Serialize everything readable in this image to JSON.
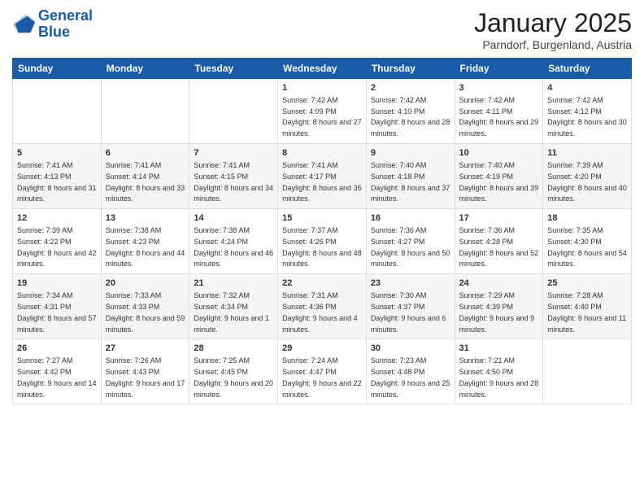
{
  "logo": {
    "line1": "General",
    "line2": "Blue"
  },
  "title": "January 2025",
  "location": "Parndorf, Burgenland, Austria",
  "weekdays": [
    "Sunday",
    "Monday",
    "Tuesday",
    "Wednesday",
    "Thursday",
    "Friday",
    "Saturday"
  ],
  "weeks": [
    [
      {
        "day": "",
        "info": ""
      },
      {
        "day": "",
        "info": ""
      },
      {
        "day": "",
        "info": ""
      },
      {
        "day": "1",
        "info": "Sunrise: 7:42 AM\nSunset: 4:09 PM\nDaylight: 8 hours and 27 minutes."
      },
      {
        "day": "2",
        "info": "Sunrise: 7:42 AM\nSunset: 4:10 PM\nDaylight: 8 hours and 28 minutes."
      },
      {
        "day": "3",
        "info": "Sunrise: 7:42 AM\nSunset: 4:11 PM\nDaylight: 8 hours and 29 minutes."
      },
      {
        "day": "4",
        "info": "Sunrise: 7:42 AM\nSunset: 4:12 PM\nDaylight: 8 hours and 30 minutes."
      }
    ],
    [
      {
        "day": "5",
        "info": "Sunrise: 7:41 AM\nSunset: 4:13 PM\nDaylight: 8 hours and 31 minutes."
      },
      {
        "day": "6",
        "info": "Sunrise: 7:41 AM\nSunset: 4:14 PM\nDaylight: 8 hours and 33 minutes."
      },
      {
        "day": "7",
        "info": "Sunrise: 7:41 AM\nSunset: 4:15 PM\nDaylight: 8 hours and 34 minutes."
      },
      {
        "day": "8",
        "info": "Sunrise: 7:41 AM\nSunset: 4:17 PM\nDaylight: 8 hours and 35 minutes."
      },
      {
        "day": "9",
        "info": "Sunrise: 7:40 AM\nSunset: 4:18 PM\nDaylight: 8 hours and 37 minutes."
      },
      {
        "day": "10",
        "info": "Sunrise: 7:40 AM\nSunset: 4:19 PM\nDaylight: 8 hours and 39 minutes."
      },
      {
        "day": "11",
        "info": "Sunrise: 7:39 AM\nSunset: 4:20 PM\nDaylight: 8 hours and 40 minutes."
      }
    ],
    [
      {
        "day": "12",
        "info": "Sunrise: 7:39 AM\nSunset: 4:22 PM\nDaylight: 8 hours and 42 minutes."
      },
      {
        "day": "13",
        "info": "Sunrise: 7:38 AM\nSunset: 4:23 PM\nDaylight: 8 hours and 44 minutes."
      },
      {
        "day": "14",
        "info": "Sunrise: 7:38 AM\nSunset: 4:24 PM\nDaylight: 8 hours and 46 minutes."
      },
      {
        "day": "15",
        "info": "Sunrise: 7:37 AM\nSunset: 4:26 PM\nDaylight: 8 hours and 48 minutes."
      },
      {
        "day": "16",
        "info": "Sunrise: 7:36 AM\nSunset: 4:27 PM\nDaylight: 8 hours and 50 minutes."
      },
      {
        "day": "17",
        "info": "Sunrise: 7:36 AM\nSunset: 4:28 PM\nDaylight: 8 hours and 52 minutes."
      },
      {
        "day": "18",
        "info": "Sunrise: 7:35 AM\nSunset: 4:30 PM\nDaylight: 8 hours and 54 minutes."
      }
    ],
    [
      {
        "day": "19",
        "info": "Sunrise: 7:34 AM\nSunset: 4:31 PM\nDaylight: 8 hours and 57 minutes."
      },
      {
        "day": "20",
        "info": "Sunrise: 7:33 AM\nSunset: 4:33 PM\nDaylight: 8 hours and 59 minutes."
      },
      {
        "day": "21",
        "info": "Sunrise: 7:32 AM\nSunset: 4:34 PM\nDaylight: 9 hours and 1 minute."
      },
      {
        "day": "22",
        "info": "Sunrise: 7:31 AM\nSunset: 4:36 PM\nDaylight: 9 hours and 4 minutes."
      },
      {
        "day": "23",
        "info": "Sunrise: 7:30 AM\nSunset: 4:37 PM\nDaylight: 9 hours and 6 minutes."
      },
      {
        "day": "24",
        "info": "Sunrise: 7:29 AM\nSunset: 4:39 PM\nDaylight: 9 hours and 9 minutes."
      },
      {
        "day": "25",
        "info": "Sunrise: 7:28 AM\nSunset: 4:40 PM\nDaylight: 9 hours and 11 minutes."
      }
    ],
    [
      {
        "day": "26",
        "info": "Sunrise: 7:27 AM\nSunset: 4:42 PM\nDaylight: 9 hours and 14 minutes."
      },
      {
        "day": "27",
        "info": "Sunrise: 7:26 AM\nSunset: 4:43 PM\nDaylight: 9 hours and 17 minutes."
      },
      {
        "day": "28",
        "info": "Sunrise: 7:25 AM\nSunset: 4:45 PM\nDaylight: 9 hours and 20 minutes."
      },
      {
        "day": "29",
        "info": "Sunrise: 7:24 AM\nSunset: 4:47 PM\nDaylight: 9 hours and 22 minutes."
      },
      {
        "day": "30",
        "info": "Sunrise: 7:23 AM\nSunset: 4:48 PM\nDaylight: 9 hours and 25 minutes."
      },
      {
        "day": "31",
        "info": "Sunrise: 7:21 AM\nSunset: 4:50 PM\nDaylight: 9 hours and 28 minutes."
      },
      {
        "day": "",
        "info": ""
      }
    ]
  ]
}
